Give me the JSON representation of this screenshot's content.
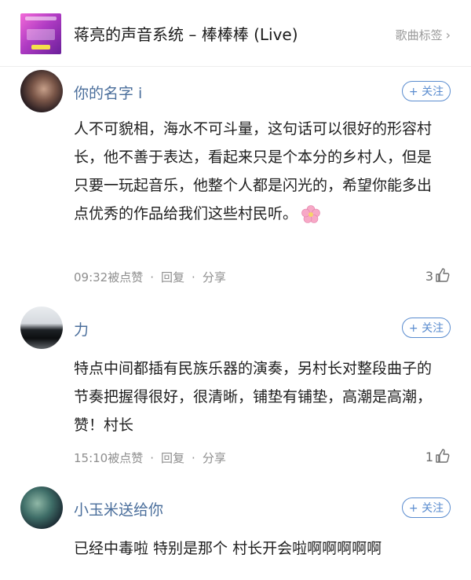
{
  "header": {
    "song_title": "蒋亮的声音系统 – 棒棒棒 (Live)",
    "tag_link_label": "歌曲标签"
  },
  "comments": [
    {
      "username": "你的名字 i",
      "follow_label": "+ 关注",
      "text": "人不可貌相，海水不可斗量，这句话可以很好的形容村长，他不善于表达，看起来只是个本分的乡村人，但是只要一玩起音乐，他整个人都是闪光的，希望你能多出点优秀的作品给我们这些村民听。",
      "emoji_icon": "cherry-blossom-icon",
      "time": "09:32",
      "liked_label": "被点赞",
      "reply_label": "回复",
      "share_label": "分享",
      "like_count": "3"
    },
    {
      "username": "力",
      "follow_label": "+ 关注",
      "text": "特点中间都插有民族乐器的演奏，另村长对整段曲子的节奏把握得很好，很清晰，铺垫有铺垫，高潮是高潮，赞！村长",
      "time": "15:10",
      "liked_label": "被点赞",
      "reply_label": "回复",
      "share_label": "分享",
      "like_count": "1"
    },
    {
      "username": "小玉米送给你",
      "follow_label": "+ 关注",
      "text": "已经中毒啦  特别是那个 村长开会啦啊啊啊啊啊"
    }
  ],
  "colors": {
    "username": "#4a6e9b",
    "follow_accent": "#5a8ccf",
    "meta_gray": "#8e8e8e"
  }
}
